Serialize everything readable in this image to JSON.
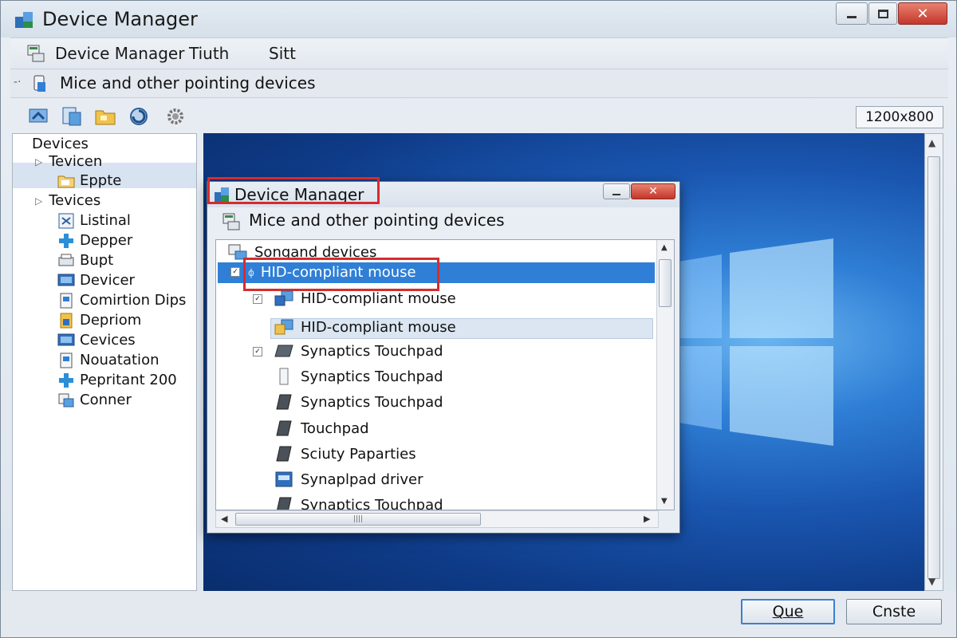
{
  "window": {
    "title": "Device Manager",
    "minimize_label": "",
    "maximize_label": "",
    "close_label": "✕"
  },
  "menubar": {
    "items": [
      "Device Manager",
      "Tiuth",
      "Sitt"
    ]
  },
  "pathbar": {
    "text": "Mice and other pointing devices"
  },
  "toolbar": {
    "buttons": [
      "back-icon",
      "properties-icon",
      "folder-icon",
      "refresh-icon",
      "settings-icon"
    ],
    "resolution": "1200x800"
  },
  "tree": {
    "items": [
      {
        "label": "Devices",
        "icon": "none"
      },
      {
        "label": "Tevicen",
        "icon": "expand-arrow"
      },
      {
        "label": "Eppte",
        "icon": "folder-icon"
      },
      {
        "label": "Tevices",
        "icon": "expand-arrow"
      },
      {
        "label": "Listinal",
        "icon": "device-icon"
      },
      {
        "label": "Depper",
        "icon": "network-icon"
      },
      {
        "label": "Bupt",
        "icon": "printer-icon"
      },
      {
        "label": "Devicer",
        "icon": "monitor-icon"
      },
      {
        "label": "Comirtion Dips",
        "icon": "document-icon"
      },
      {
        "label": "Depriom",
        "icon": "card-icon"
      },
      {
        "label": "Cevices",
        "icon": "monitor-icon"
      },
      {
        "label": "Nouatation",
        "icon": "document-icon"
      },
      {
        "label": "Pepritant 200",
        "icon": "network-icon"
      },
      {
        "label": "Conner",
        "icon": "connector-icon"
      }
    ]
  },
  "dialog": {
    "title": "Device Manager",
    "close_label": "✕",
    "subtitle": "Mice and other pointing devices",
    "list": [
      {
        "label": "Songand devices",
        "icon": "devices-icon"
      },
      {
        "label": "HID-compliant mouse",
        "icon": "mouse-icon",
        "selected": true
      },
      {
        "label": "HID-compliant mouse",
        "icon": "mouse-icon"
      },
      {
        "label": "HID-compliant mouse",
        "icon": "mouse-icon",
        "hover": true
      },
      {
        "label": "Synaptics Touchpad",
        "icon": "touchpad-icon"
      },
      {
        "label": "Synaptics Touchpad",
        "icon": "touchpad-icon"
      },
      {
        "label": "Synaptics Touchpad",
        "icon": "touchpad-icon"
      },
      {
        "label": "Touchpad",
        "icon": "touchpad-icon"
      },
      {
        "label": "Sciuty Paparties",
        "icon": "touchpad-icon"
      },
      {
        "label": "Synaplpad driver",
        "icon": "driver-icon"
      },
      {
        "label": "Synaptics Touchpad",
        "icon": "touchpad-icon"
      }
    ]
  },
  "buttons": {
    "ok": "Que",
    "cancel": "Cnste"
  },
  "colors": {
    "selection": "#2f7fd6",
    "highlight_box": "#d62c2c",
    "desktop_blue": "#1a56b0"
  }
}
